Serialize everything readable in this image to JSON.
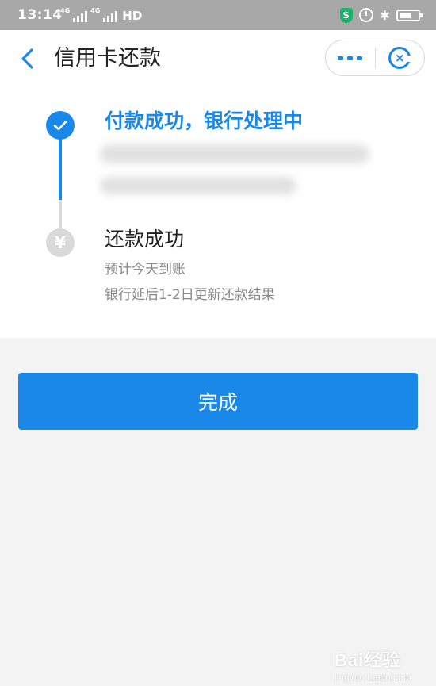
{
  "status_bar": {
    "time": "13:14",
    "network_1": "4G",
    "network_2": "4G",
    "hd_label": "HD",
    "shield_glyph": "$",
    "bluetooth_glyph": "✱"
  },
  "nav": {
    "title": "信用卡还款",
    "more_icon": "more-dots-icon",
    "close_icon": "close-miniprogram-icon",
    "close_glyph": "×"
  },
  "steps": [
    {
      "title": "付款成功，银行处理中",
      "state": "done",
      "icon": "check-icon"
    },
    {
      "title": "还款成功",
      "state": "pending",
      "icon": "yen-icon",
      "glyph": "¥",
      "lines": [
        "预计今天到账",
        "银行延后1-2日更新还款结果"
      ]
    }
  ],
  "done_button": {
    "label": "完成"
  },
  "watermark": {
    "brand": "Bai经验",
    "url": "jingyan.baidu.com"
  },
  "colors": {
    "accent": "#1a88e8",
    "inactive": "#d9d9d9",
    "background": "#f3f3f3"
  }
}
